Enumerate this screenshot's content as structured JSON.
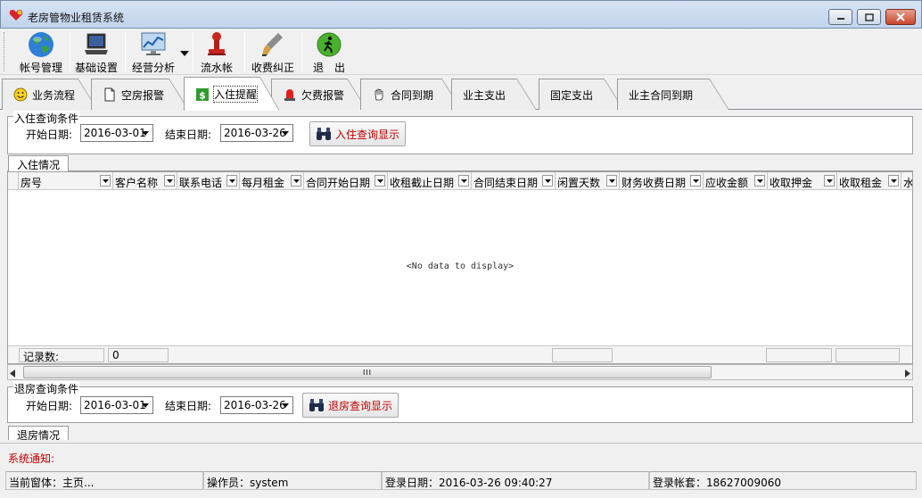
{
  "window": {
    "title": "老房管物业租赁系统"
  },
  "toolbar": {
    "items": [
      {
        "label": "帐号管理",
        "icon": "globe-icon"
      },
      {
        "label": "基础设置",
        "icon": "laptop-icon"
      },
      {
        "label": "经营分析",
        "icon": "monitor-chart-icon"
      },
      {
        "label": "流水帐",
        "icon": "stamp-icon"
      },
      {
        "label": "收费纠正",
        "icon": "brush-icon"
      },
      {
        "label": "退　出",
        "icon": "exit-icon"
      }
    ]
  },
  "tabs": [
    {
      "label": "业务流程",
      "icon": "smiley-icon"
    },
    {
      "label": "空房报警",
      "icon": "page-icon"
    },
    {
      "label": "入住提醒",
      "icon": "money-icon",
      "active": true
    },
    {
      "label": "欠费报警",
      "icon": "alarm-icon"
    },
    {
      "label": "合同到期",
      "icon": "hand-icon"
    },
    {
      "label": "业主支出",
      "icon": ""
    },
    {
      "label": "固定支出",
      "icon": ""
    },
    {
      "label": "业主合同到期",
      "icon": ""
    }
  ],
  "checkin_query": {
    "legend": "入住查询条件",
    "start_label": "开始日期:",
    "start_value": "2016-03-01",
    "end_label": "结束日期:",
    "end_value": "2016-03-26",
    "button": "入住查询显示"
  },
  "checkin_grid": {
    "tab": "入住情况",
    "columns": [
      "房号",
      "客户名称",
      "联系电话",
      "每月租金",
      "合同开始日期",
      "收租截止日期",
      "合同结束日期",
      "闲置天数",
      "财务收费日期",
      "应收金额",
      "收取押金",
      "收取租金",
      "水"
    ],
    "empty_text": "<No data to display>",
    "record_label": "记录数:",
    "record_count": "0",
    "scroll_marker": "III"
  },
  "checkout_query": {
    "legend": "退房查询条件",
    "start_label": "开始日期:",
    "start_value": "2016-03-01",
    "end_label": "结束日期:",
    "end_value": "2016-03-26",
    "button": "退房查询显示"
  },
  "checkout_grid": {
    "tab": "退房情况"
  },
  "notice": {
    "label": "系统通知:"
  },
  "status": {
    "current": "当前窗体：主页...",
    "operator": "操作员：system",
    "login_date": "登录日期：2016-03-26 09:40:27",
    "account": "登录帐套：18627009060"
  },
  "colors": {
    "accent_red": "#c00000",
    "tab_border": "#9a9a9a"
  }
}
